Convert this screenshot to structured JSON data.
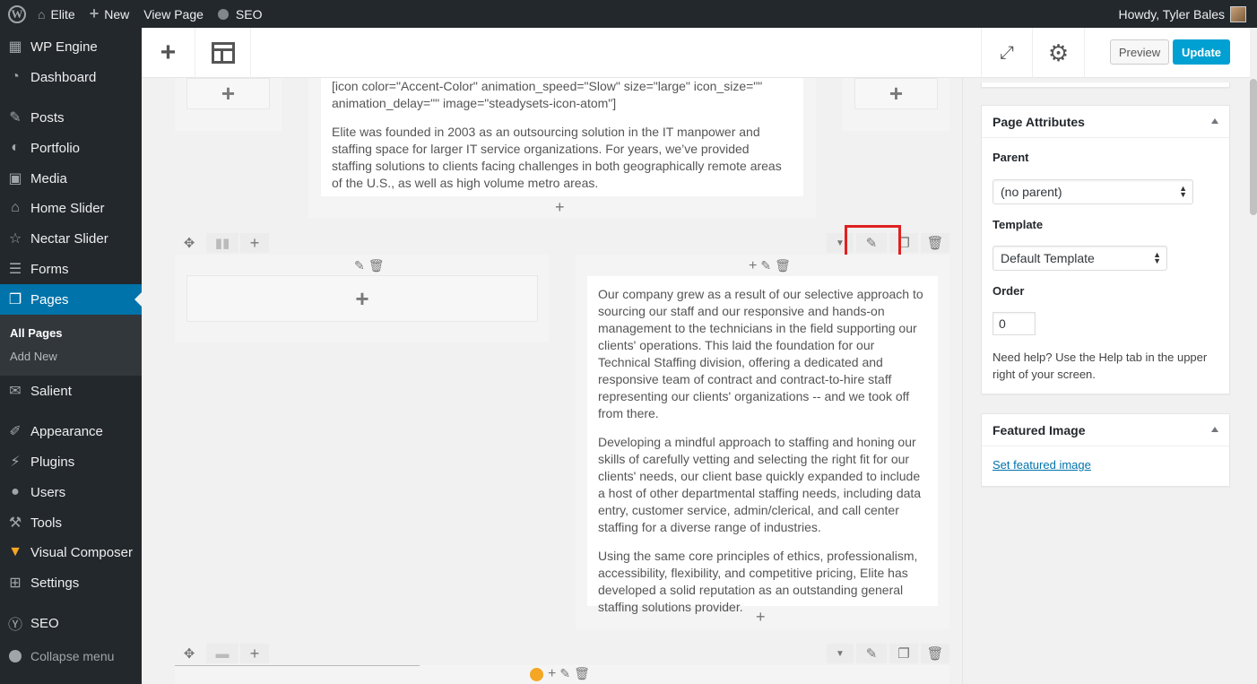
{
  "adminbar": {
    "site_name": "Elite",
    "new_label": "New",
    "view_page": "View Page",
    "seo": "SEO",
    "howdy": "Howdy, Tyler Bales"
  },
  "menu": {
    "items": [
      {
        "label": "WP Engine",
        "icon": "wpengine-icon"
      },
      {
        "label": "Dashboard",
        "icon": "dashboard-icon"
      },
      {
        "label": "Posts",
        "icon": "pin-icon"
      },
      {
        "label": "Portfolio",
        "icon": "portfolio-icon"
      },
      {
        "label": "Media",
        "icon": "media-icon"
      },
      {
        "label": "Home Slider",
        "icon": "home-icon"
      },
      {
        "label": "Nectar Slider",
        "icon": "star-icon"
      },
      {
        "label": "Forms",
        "icon": "forms-icon"
      },
      {
        "label": "Pages",
        "icon": "pages-icon"
      },
      {
        "label": "Salient",
        "icon": "mail-icon"
      },
      {
        "label": "Appearance",
        "icon": "brush-icon"
      },
      {
        "label": "Plugins",
        "icon": "plugin-icon"
      },
      {
        "label": "Users",
        "icon": "user-icon"
      },
      {
        "label": "Tools",
        "icon": "wrench-icon"
      },
      {
        "label": "Visual Composer",
        "icon": "vc-icon"
      },
      {
        "label": "Settings",
        "icon": "settings-icon"
      },
      {
        "label": "SEO",
        "icon": "seo-icon"
      }
    ],
    "sub_all_pages": "All Pages",
    "sub_add_new": "Add New",
    "collapse": "Collapse menu"
  },
  "toolbar": {
    "preview": "Preview",
    "update": "Update"
  },
  "canvas": {
    "top_text_shortcode": "[icon color=\"Accent-Color\" animation_speed=\"Slow\" size=\"large\" icon_size=\"\" animation_delay=\"\" image=\"steadysets-icon-atom\"]",
    "top_text_para": "Elite was founded in 2003 as an outsourcing solution in the IT manpower and staffing space for larger IT service organizations. For years, we’ve provided staffing solutions to clients facing challenges in both geographically remote areas of the U.S., as well as high volume metro areas.",
    "right_para_1": "Our company grew as a result of our selective approach to sourcing our staff and our responsive and hands-on management to the technicians in the field supporting our clients' operations. This laid the foundation for our Technical Staffing division, offering a dedicated and responsive team of contract and contract-to-hire staff representing our clients' organizations -- and we took off from there.",
    "right_para_2": "Developing a mindful approach to staffing and honing our skills of carefully vetting and selecting the right fit for our clients' needs, our client base quickly expanded to include a host of other departmental staffing needs, including data entry, customer service, admin/clerical, and call center staffing for a diverse range of industries.",
    "right_para_3": "Using the same core principles of ethics, professionalism, accessibility, flexibility, and competitive pricing, Elite has developed a solid reputation as an outstanding general staffing solutions provider."
  },
  "page_attributes": {
    "title": "Page Attributes",
    "parent_label": "Parent",
    "parent_value": "(no parent)",
    "template_label": "Template",
    "template_value": "Default Template",
    "order_label": "Order",
    "order_value": "0",
    "help": "Need help? Use the Help tab in the upper right of your screen."
  },
  "featured_image": {
    "title": "Featured Image",
    "link": "Set featured image"
  },
  "colors": {
    "admin_dark": "#23282d",
    "accent_blue": "#0073aa",
    "update_blue": "#00a0d2",
    "highlight_red": "#e02020",
    "orange_dot": "#f5a623"
  }
}
